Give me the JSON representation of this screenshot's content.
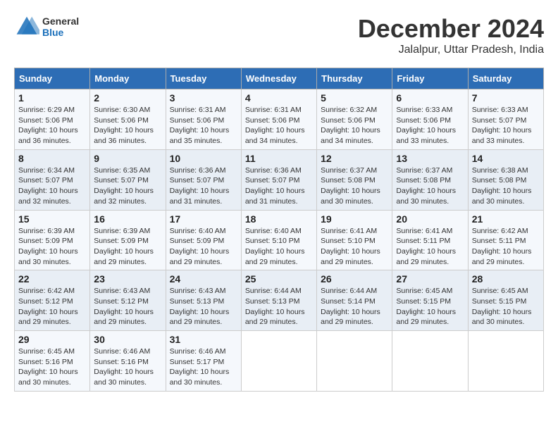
{
  "header": {
    "logo_general": "General",
    "logo_blue": "Blue",
    "month_title": "December 2024",
    "location": "Jalalpur, Uttar Pradesh, India"
  },
  "calendar": {
    "days_of_week": [
      "Sunday",
      "Monday",
      "Tuesday",
      "Wednesday",
      "Thursday",
      "Friday",
      "Saturday"
    ],
    "weeks": [
      [
        null,
        {
          "day": "2",
          "sunrise": "Sunrise: 6:30 AM",
          "sunset": "Sunset: 5:06 PM",
          "daylight": "Daylight: 10 hours and 36 minutes."
        },
        {
          "day": "3",
          "sunrise": "Sunrise: 6:31 AM",
          "sunset": "Sunset: 5:06 PM",
          "daylight": "Daylight: 10 hours and 35 minutes."
        },
        {
          "day": "4",
          "sunrise": "Sunrise: 6:31 AM",
          "sunset": "Sunset: 5:06 PM",
          "daylight": "Daylight: 10 hours and 34 minutes."
        },
        {
          "day": "5",
          "sunrise": "Sunrise: 6:32 AM",
          "sunset": "Sunset: 5:06 PM",
          "daylight": "Daylight: 10 hours and 34 minutes."
        },
        {
          "day": "6",
          "sunrise": "Sunrise: 6:33 AM",
          "sunset": "Sunset: 5:06 PM",
          "daylight": "Daylight: 10 hours and 33 minutes."
        },
        {
          "day": "7",
          "sunrise": "Sunrise: 6:33 AM",
          "sunset": "Sunset: 5:07 PM",
          "daylight": "Daylight: 10 hours and 33 minutes."
        }
      ],
      [
        {
          "day": "1",
          "sunrise": "Sunrise: 6:29 AM",
          "sunset": "Sunset: 5:06 PM",
          "daylight": "Daylight: 10 hours and 36 minutes."
        },
        null,
        null,
        null,
        null,
        null,
        null
      ],
      [
        {
          "day": "8",
          "sunrise": "Sunrise: 6:34 AM",
          "sunset": "Sunset: 5:07 PM",
          "daylight": "Daylight: 10 hours and 32 minutes."
        },
        {
          "day": "9",
          "sunrise": "Sunrise: 6:35 AM",
          "sunset": "Sunset: 5:07 PM",
          "daylight": "Daylight: 10 hours and 32 minutes."
        },
        {
          "day": "10",
          "sunrise": "Sunrise: 6:36 AM",
          "sunset": "Sunset: 5:07 PM",
          "daylight": "Daylight: 10 hours and 31 minutes."
        },
        {
          "day": "11",
          "sunrise": "Sunrise: 6:36 AM",
          "sunset": "Sunset: 5:07 PM",
          "daylight": "Daylight: 10 hours and 31 minutes."
        },
        {
          "day": "12",
          "sunrise": "Sunrise: 6:37 AM",
          "sunset": "Sunset: 5:08 PM",
          "daylight": "Daylight: 10 hours and 30 minutes."
        },
        {
          "day": "13",
          "sunrise": "Sunrise: 6:37 AM",
          "sunset": "Sunset: 5:08 PM",
          "daylight": "Daylight: 10 hours and 30 minutes."
        },
        {
          "day": "14",
          "sunrise": "Sunrise: 6:38 AM",
          "sunset": "Sunset: 5:08 PM",
          "daylight": "Daylight: 10 hours and 30 minutes."
        }
      ],
      [
        {
          "day": "15",
          "sunrise": "Sunrise: 6:39 AM",
          "sunset": "Sunset: 5:09 PM",
          "daylight": "Daylight: 10 hours and 30 minutes."
        },
        {
          "day": "16",
          "sunrise": "Sunrise: 6:39 AM",
          "sunset": "Sunset: 5:09 PM",
          "daylight": "Daylight: 10 hours and 29 minutes."
        },
        {
          "day": "17",
          "sunrise": "Sunrise: 6:40 AM",
          "sunset": "Sunset: 5:09 PM",
          "daylight": "Daylight: 10 hours and 29 minutes."
        },
        {
          "day": "18",
          "sunrise": "Sunrise: 6:40 AM",
          "sunset": "Sunset: 5:10 PM",
          "daylight": "Daylight: 10 hours and 29 minutes."
        },
        {
          "day": "19",
          "sunrise": "Sunrise: 6:41 AM",
          "sunset": "Sunset: 5:10 PM",
          "daylight": "Daylight: 10 hours and 29 minutes."
        },
        {
          "day": "20",
          "sunrise": "Sunrise: 6:41 AM",
          "sunset": "Sunset: 5:11 PM",
          "daylight": "Daylight: 10 hours and 29 minutes."
        },
        {
          "day": "21",
          "sunrise": "Sunrise: 6:42 AM",
          "sunset": "Sunset: 5:11 PM",
          "daylight": "Daylight: 10 hours and 29 minutes."
        }
      ],
      [
        {
          "day": "22",
          "sunrise": "Sunrise: 6:42 AM",
          "sunset": "Sunset: 5:12 PM",
          "daylight": "Daylight: 10 hours and 29 minutes."
        },
        {
          "day": "23",
          "sunrise": "Sunrise: 6:43 AM",
          "sunset": "Sunset: 5:12 PM",
          "daylight": "Daylight: 10 hours and 29 minutes."
        },
        {
          "day": "24",
          "sunrise": "Sunrise: 6:43 AM",
          "sunset": "Sunset: 5:13 PM",
          "daylight": "Daylight: 10 hours and 29 minutes."
        },
        {
          "day": "25",
          "sunrise": "Sunrise: 6:44 AM",
          "sunset": "Sunset: 5:13 PM",
          "daylight": "Daylight: 10 hours and 29 minutes."
        },
        {
          "day": "26",
          "sunrise": "Sunrise: 6:44 AM",
          "sunset": "Sunset: 5:14 PM",
          "daylight": "Daylight: 10 hours and 29 minutes."
        },
        {
          "day": "27",
          "sunrise": "Sunrise: 6:45 AM",
          "sunset": "Sunset: 5:15 PM",
          "daylight": "Daylight: 10 hours and 29 minutes."
        },
        {
          "day": "28",
          "sunrise": "Sunrise: 6:45 AM",
          "sunset": "Sunset: 5:15 PM",
          "daylight": "Daylight: 10 hours and 30 minutes."
        }
      ],
      [
        {
          "day": "29",
          "sunrise": "Sunrise: 6:45 AM",
          "sunset": "Sunset: 5:16 PM",
          "daylight": "Daylight: 10 hours and 30 minutes."
        },
        {
          "day": "30",
          "sunrise": "Sunrise: 6:46 AM",
          "sunset": "Sunset: 5:16 PM",
          "daylight": "Daylight: 10 hours and 30 minutes."
        },
        {
          "day": "31",
          "sunrise": "Sunrise: 6:46 AM",
          "sunset": "Sunset: 5:17 PM",
          "daylight": "Daylight: 10 hours and 30 minutes."
        },
        null,
        null,
        null,
        null
      ]
    ]
  }
}
